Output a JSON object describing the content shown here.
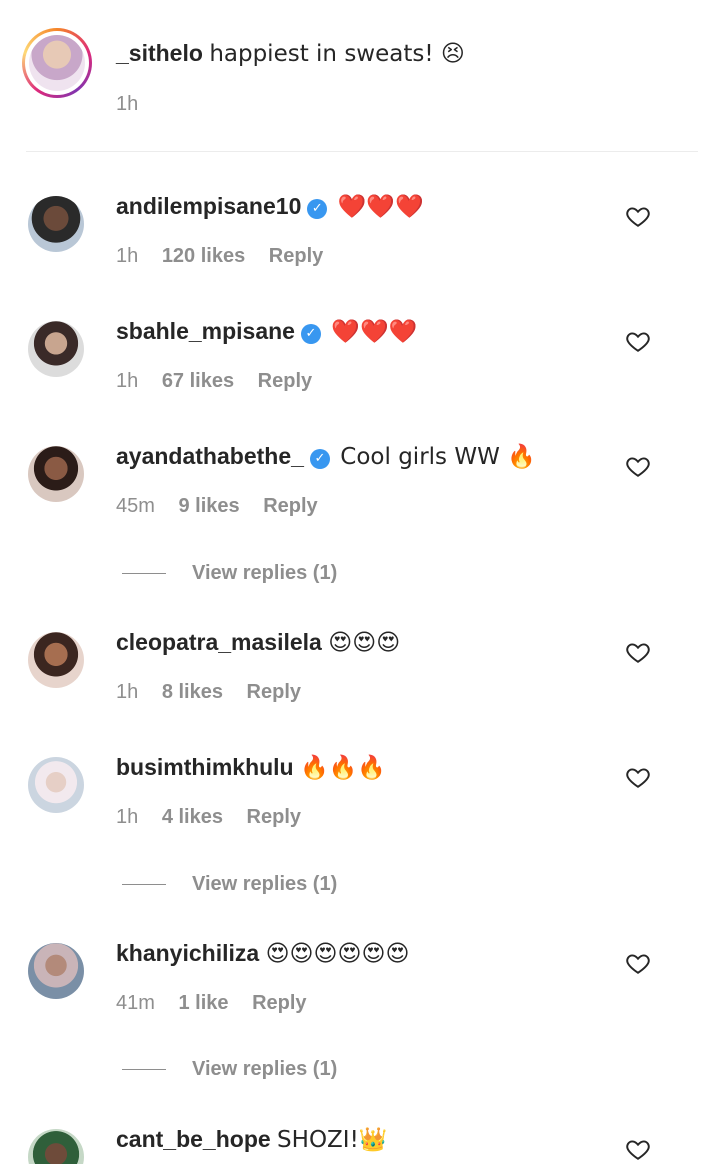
{
  "caption": {
    "username": "_sithelo",
    "text": "happiest in sweats! 😣",
    "time": "1h"
  },
  "comments": [
    {
      "username": "andilempisane10",
      "verified": true,
      "text": "❤️❤️❤️",
      "time": "1h",
      "likes": "120 likes",
      "reply": "Reply"
    },
    {
      "username": "sbahle_mpisane",
      "verified": true,
      "text": "❤️❤️❤️",
      "time": "1h",
      "likes": "67 likes",
      "reply": "Reply"
    },
    {
      "username": "ayandathabethe_",
      "verified": true,
      "text": "Cool girls WW 🔥",
      "time": "45m",
      "likes": "9 likes",
      "reply": "Reply",
      "view_replies": "View replies (1)"
    },
    {
      "username": "cleopatra_masilela",
      "verified": false,
      "text": "😍😍😍",
      "time": "1h",
      "likes": "8 likes",
      "reply": "Reply"
    },
    {
      "username": "busimthimkhulu",
      "verified": false,
      "text": "🔥🔥🔥",
      "time": "1h",
      "likes": "4 likes",
      "reply": "Reply",
      "view_replies": "View replies (1)"
    },
    {
      "username": "khanyichiliza",
      "verified": false,
      "text": "😍😍😍😍😍😍",
      "time": "41m",
      "likes": "1 like",
      "reply": "Reply",
      "view_replies": "View replies (1)"
    },
    {
      "username": "cant_be_hope",
      "verified": false,
      "text": "SHOZI!👑",
      "time": "",
      "likes": "",
      "reply": ""
    }
  ],
  "icons": {
    "heart": "heart-outline-icon",
    "verified": "verified-badge-icon"
  },
  "colors": {
    "verified": "#3897f0",
    "meta": "#8e8e8e",
    "text": "#262626"
  }
}
